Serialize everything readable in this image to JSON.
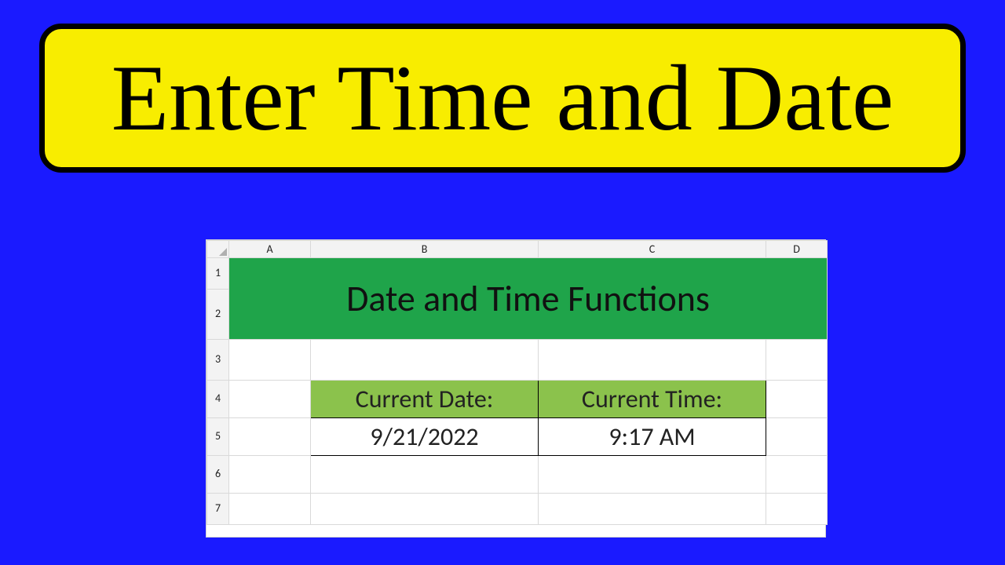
{
  "title": "Enter Time and Date",
  "sheet": {
    "columns": [
      "A",
      "B",
      "C",
      "D"
    ],
    "rows": [
      "1",
      "2",
      "3",
      "4",
      "5",
      "6",
      "7"
    ],
    "banner": "Date and Time Functions",
    "table": {
      "headers": {
        "b": "Current Date:",
        "c": "Current Time:"
      },
      "values": {
        "b": "9/21/2022",
        "c": "9:17 AM"
      }
    }
  }
}
